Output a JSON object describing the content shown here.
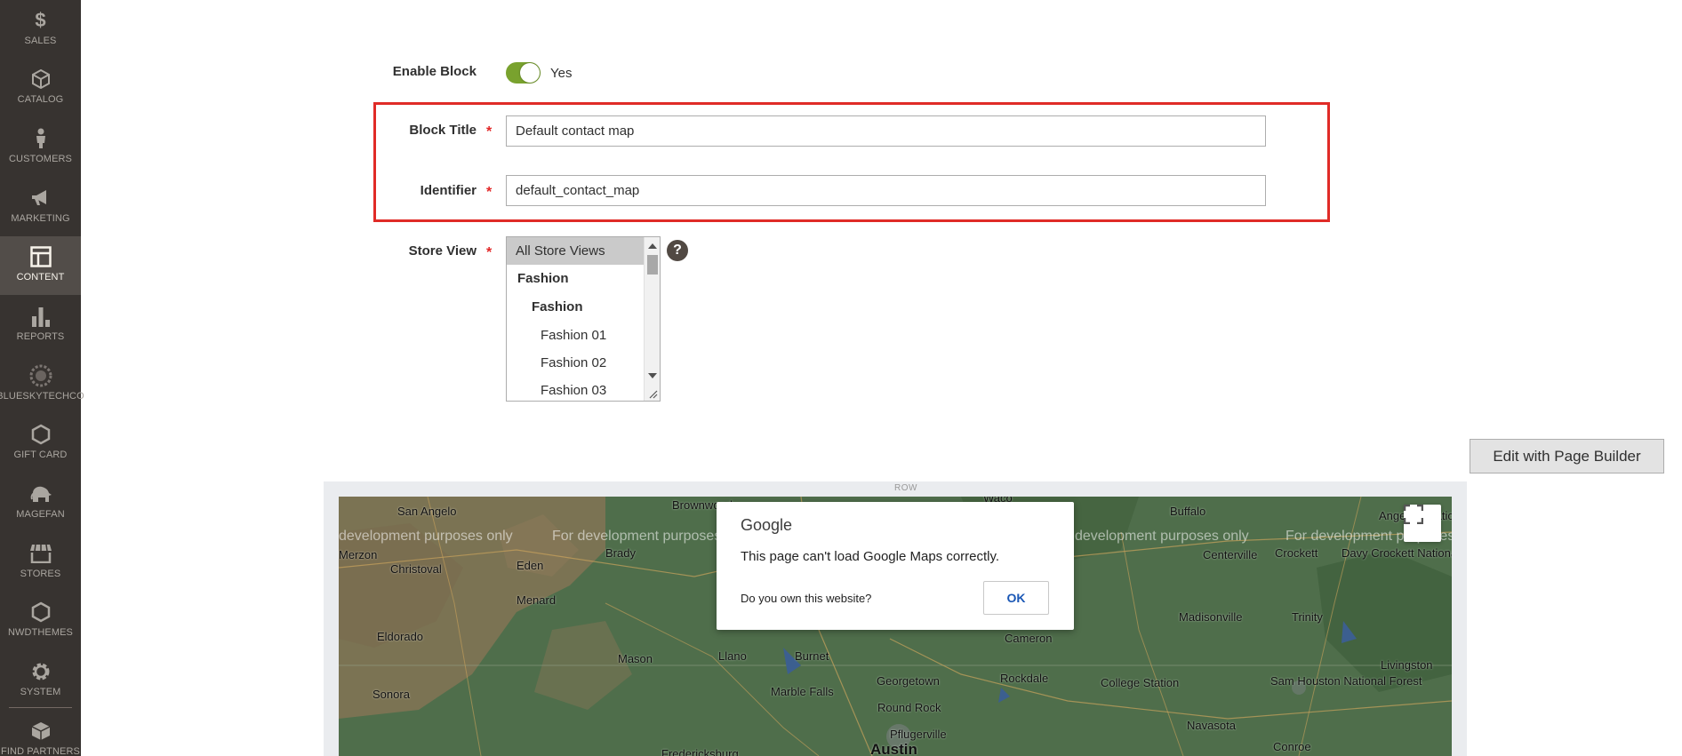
{
  "sidebar": {
    "items": [
      {
        "label": "SALES",
        "icon": "dollar-icon"
      },
      {
        "label": "CATALOG",
        "icon": "cube-icon"
      },
      {
        "label": "CUSTOMERS",
        "icon": "person-icon"
      },
      {
        "label": "MARKETING",
        "icon": "megaphone-icon"
      },
      {
        "label": "CONTENT",
        "icon": "layout-icon"
      },
      {
        "label": "REPORTS",
        "icon": "bar-chart-icon"
      },
      {
        "label": "BLUESKYTECHCO",
        "icon": "gear-logo-icon"
      },
      {
        "label": "GIFT CARD",
        "icon": "hexagon-icon"
      },
      {
        "label": "MAGEFAN",
        "icon": "elephant-icon"
      },
      {
        "label": "STORES",
        "icon": "storefront-icon"
      },
      {
        "label": "NWDTHEMES",
        "icon": "hexagon-icon"
      },
      {
        "label": "SYSTEM",
        "icon": "gear-icon"
      },
      {
        "label": "FIND PARTNERS",
        "icon": "box-icon"
      }
    ],
    "active": "CONTENT"
  },
  "form": {
    "enable_block": {
      "label": "Enable Block",
      "value_text": "Yes",
      "enabled": true
    },
    "block_title": {
      "label": "Block Title",
      "value": "Default contact map"
    },
    "identifier": {
      "label": "Identifier",
      "value": "default_contact_map"
    },
    "store_view": {
      "label": "Store View",
      "options": [
        "All Store Views",
        "Fashion",
        "Fashion",
        "Fashion 01",
        "Fashion 02",
        "Fashion 03"
      ],
      "selected": "All Store Views"
    },
    "required_mark": "*",
    "help_glyph": "?"
  },
  "page_builder": {
    "button_label": "Edit with Page Builder",
    "row_label": "ROW"
  },
  "map": {
    "watermark": "For development purposes only",
    "watermark_partial": "development purposes only",
    "cities": [
      "San Angelo",
      "Brownwood",
      "Waco",
      "Buffalo",
      "Angelina National Forest",
      "Merzon",
      "Christoval",
      "Eden",
      "Brady",
      "Centerville",
      "Crockett",
      "Davy Crockett National Forest",
      "Menard",
      "Madisonville",
      "Trinity",
      "Eldorado",
      "Mason",
      "Llano",
      "Burnet",
      "Cameron",
      "Sonora",
      "Georgetown",
      "Rockdale",
      "College Station",
      "Sam Houston National Forest",
      "Livingston",
      "Marble Falls",
      "Round Rock",
      "Navasota",
      "Pflugerville",
      "Fredericksburg",
      "Austin",
      "Conroe"
    ],
    "dialog": {
      "brand": "Google",
      "message": "This page can't load Google Maps correctly.",
      "question": "Do you own this website?",
      "ok": "OK"
    }
  }
}
